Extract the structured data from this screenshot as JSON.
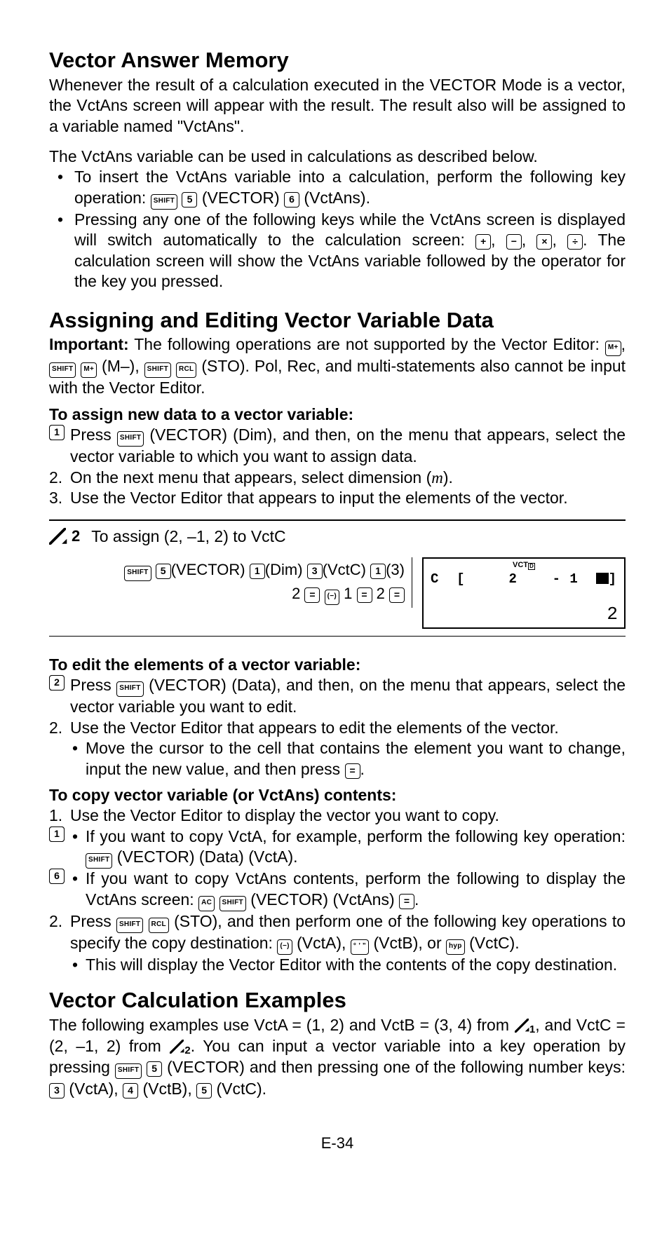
{
  "head1": "Vector Answer Memory",
  "p1": "Whenever the result of a calculation executed in the VECTOR Mode is a vector, the VctAns screen will appear with the result. The result also will be assigned to a variable named \"VctAns\".",
  "p2": "The VctAns variable can be used in calculations as described below.",
  "b1a": "To insert the VctAns variable into a calculation, perform the following key operation: ",
  "b1b": "(VECTOR)",
  "b1c": "(VctAns).",
  "b2a": "Pressing any one of the following keys while the VctAns screen is displayed will switch automatically to the calculation screen: ",
  "b2b": ". The calculation screen will show the VctAns variable followed by the operator for the key you pressed.",
  "head2": "Assigning and Editing Vector Variable Data",
  "imp_a": "Important:",
  "imp_b": " The following operations are not supported by the Vector Editor: ",
  "imp_c": "(M–), ",
  "imp_d": "(STO). Pol, Rec, and multi-statements also cannot be input with the Vector Editor.",
  "sub1": "To assign new data to a vector variable:",
  "n1a": "Press ",
  "n1b": "(VECTOR)",
  "n1c": "(Dim), and then, on the menu that appears, select the vector variable to which you want to assign data.",
  "n2a": "On the next menu that appears, select dimension (",
  "n2b": ").",
  "n3": "Use the Vector Editor that appears to input the elements of the vector.",
  "ex_label": "To assign (2, –1, 2) to VctC",
  "ex_seq1a": "(VECTOR)",
  "ex_seq1b": "(Dim)",
  "ex_seq1c": "(VctC)",
  "ex_seq1d": "(3)",
  "ex_seq2": "2",
  "ex_seq3": "1",
  "ex_seq4": "2",
  "lcd_top": "VCT",
  "lcd_c": "C",
  "lcd_v1": "2",
  "lcd_v2": "- 1",
  "lcd_rb": "]",
  "lcd_bot": "2",
  "sub2": "To edit the elements of a vector variable:",
  "e1a": "Press ",
  "e1b": "(VECTOR)",
  "e1c": "(Data), and then, on the menu that appears, select the vector variable you want to edit.",
  "e2": "Use the Vector Editor that appears to edit the elements of the vector.",
  "e2s1": "Move the cursor to the cell that contains the element you want to change, input the new value, and then press ",
  "e2s1b": ".",
  "sub3": "To copy vector variable (or VctAns) contents:",
  "c1": "Use the Vector Editor to display the vector you want to copy.",
  "c1s1a": "If you want to copy VctA, for example, perform the following key operation: ",
  "c1s1b": "(VECTOR)",
  "c1s1c": "(Data)",
  "c1s1d": "(VctA).",
  "c1s2a": "If you want to copy VctAns contents, perform the following to display the VctAns screen: ",
  "c1s2b": "(VECTOR)",
  "c1s2c": "(VctAns)",
  "c1s2d": ".",
  "c2a": "Press ",
  "c2b": "(STO), and then perform one of the following key operations to specify the copy destination: ",
  "c2c": "(VctA), ",
  "c2d": "(VctB), or ",
  "c2e": "(VctC).",
  "c2s1": "This will display the Vector Editor with the contents of the copy destination.",
  "head3": "Vector Calculation Examples",
  "vex_a": "The following examples use VctA = (1, 2) and VctB = (3, 4) from ",
  "vex_b": ", and VctC = (2, –1, 2) from ",
  "vex_c": ". You can input a vector variable into a key operation by pressing ",
  "vex_d": "(VECTOR) and then pressing one of the following number keys: ",
  "vex_e": "(VctA), ",
  "vex_f": "(VctB), ",
  "vex_g": "(VctC).",
  "keys": {
    "shift": "SHIFT",
    "mplus": "M+",
    "rcl": "RCL",
    "ac": "AC",
    "k1": "1",
    "k2": "2",
    "k3": "3",
    "k4": "4",
    "k5": "5",
    "k6": "6",
    "plus": "+",
    "minus": "−",
    "mult": "×",
    "div": "÷",
    "eq": "=",
    "neg": "(−)",
    "dms": "° ’ ”",
    "hyp": "hyp"
  },
  "mvar": "m",
  "page": "E-34"
}
